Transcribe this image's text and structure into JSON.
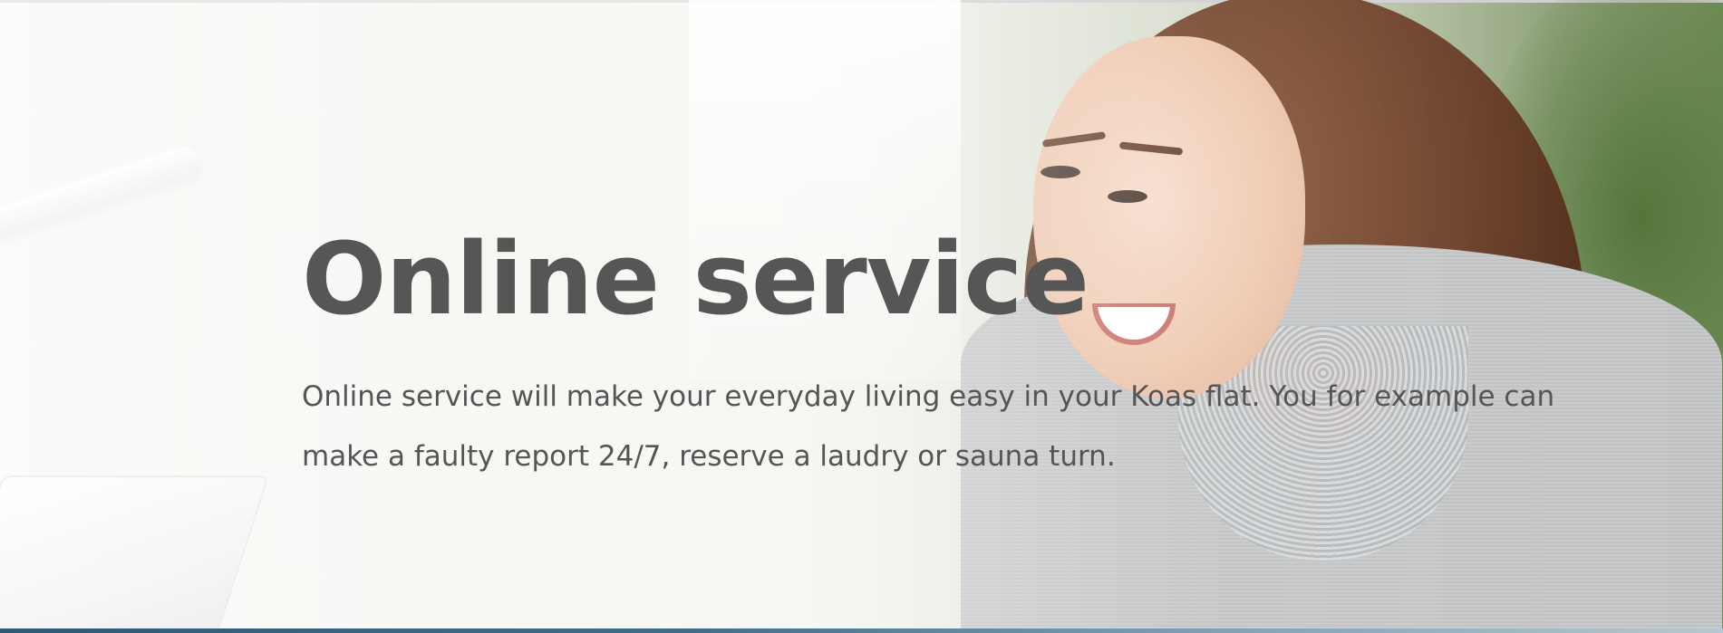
{
  "hero": {
    "title": "Online service",
    "description": "Online service will make your everyday living easy in your Koas flat. You for example can make a faulty report 24/7, reserve a laudry or sauna turn.",
    "image_subject": "smiling-woman-at-laptop-photo"
  },
  "colors": {
    "text": "#565656",
    "bottom_strip": "#2c5b7a"
  }
}
